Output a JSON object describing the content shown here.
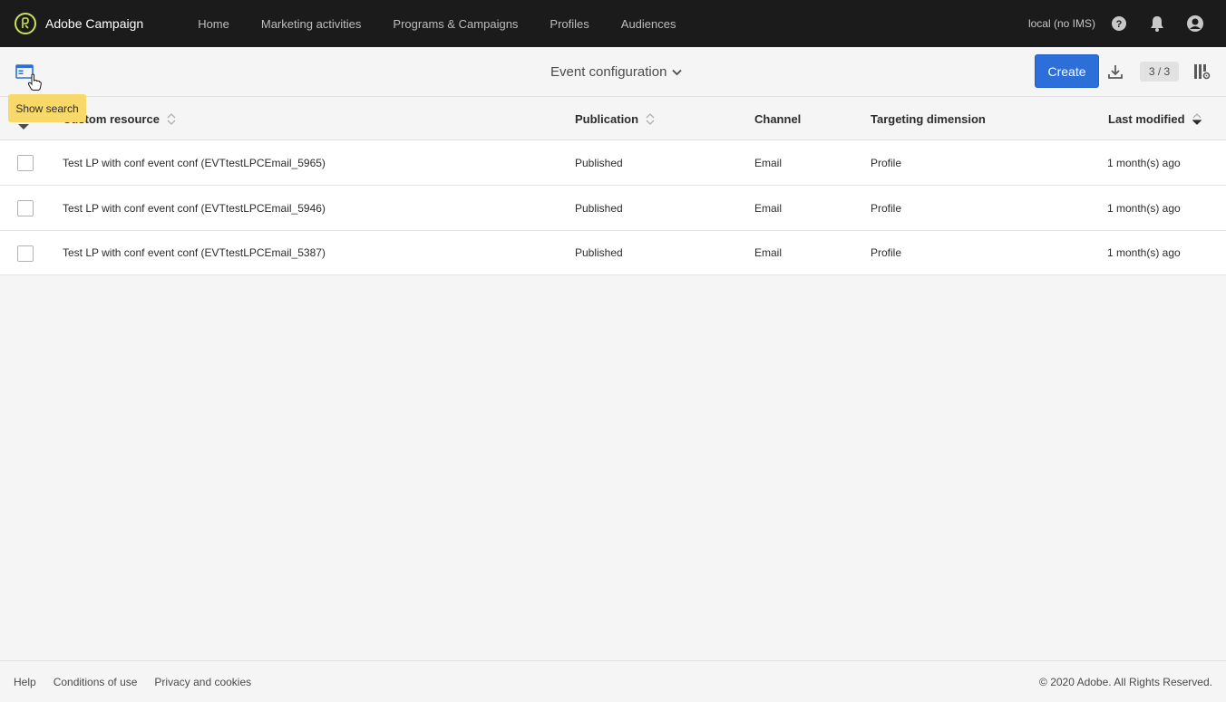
{
  "app": {
    "brand_name": "Adobe Campaign",
    "accent_color": "#cbe35a"
  },
  "nav": {
    "items": [
      {
        "label": "Home"
      },
      {
        "label": "Marketing activities"
      },
      {
        "label": "Programs & Campaigns"
      },
      {
        "label": "Profiles"
      },
      {
        "label": "Audiences"
      }
    ],
    "environment": "local (no IMS)",
    "icons": [
      "help-icon",
      "bell-icon",
      "user-avatar-icon"
    ]
  },
  "toolbar": {
    "view_title": "Event configuration",
    "create_label": "Create",
    "count": "3 / 3",
    "create_color": "#2c6fd8"
  },
  "tooltip": {
    "text": "Show search",
    "color": "#f8d868"
  },
  "table": {
    "columns": [
      {
        "label": "Custom resource",
        "sortable": true
      },
      {
        "label": "Publication",
        "sortable": true
      },
      {
        "label": "Channel",
        "sortable": false
      },
      {
        "label": "Targeting dimension",
        "sortable": false
      },
      {
        "label": "Last modified",
        "sortable": true,
        "sorted": "descending"
      }
    ],
    "rows": [
      {
        "name": "Test LP with conf event conf (EVTtestLPCEmail_5965)",
        "publication": "Published",
        "channel": "Email",
        "targeting": "Profile",
        "modified": "1 month(s) ago"
      },
      {
        "name": "Test LP with conf event conf (EVTtestLPCEmail_5946)",
        "publication": "Published",
        "channel": "Email",
        "targeting": "Profile",
        "modified": "1 month(s) ago"
      },
      {
        "name": "Test LP with conf event conf (EVTtestLPCEmail_5387)",
        "publication": "Published",
        "channel": "Email",
        "targeting": "Profile",
        "modified": "1 month(s) ago"
      }
    ]
  },
  "footer": {
    "links": [
      {
        "label": "Help"
      },
      {
        "label": "Conditions of use"
      },
      {
        "label": "Privacy and cookies"
      }
    ],
    "copyright": "© 2020 Adobe. All Rights Reserved."
  }
}
